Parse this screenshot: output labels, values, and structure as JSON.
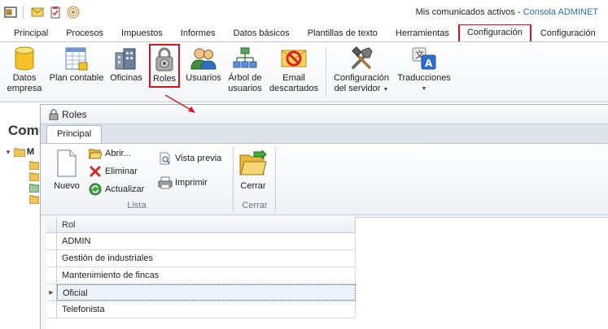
{
  "window": {
    "title_prefix": "Mis comunicados activos - ",
    "app_name": "Consola ADMINET"
  },
  "quick_access": [
    "app-menu-icon",
    "mail-icon",
    "clipboard-check-icon",
    "rss-icon"
  ],
  "menu_tabs": [
    {
      "label": "Principal"
    },
    {
      "label": "Procesos"
    },
    {
      "label": "Impuestos"
    },
    {
      "label": "Informes"
    },
    {
      "label": "Datos básicos"
    },
    {
      "label": "Plantillas de texto"
    },
    {
      "label": "Herramientas"
    },
    {
      "label": "Configuración",
      "active": true
    },
    {
      "label": "Configuración"
    }
  ],
  "ribbon": {
    "datos_empresa": "Datos\nempresa",
    "plan_contable": "Plan contable",
    "oficinas": "Oficinas",
    "roles": "Roles",
    "usuarios": "Usuarios",
    "arbol_usuarios": "Árbol de\nusuarios",
    "email_descartados": "Email\ndescartados",
    "config_servidor": "Configuración\ndel servidor",
    "traducciones": "Traducciones"
  },
  "background": {
    "title": "Comu",
    "tree_root": "M"
  },
  "child_window": {
    "title": "Roles",
    "tab": "Principal",
    "buttons": {
      "nuevo": "Nuevo",
      "abrir": "Abrir...",
      "eliminar": "Eliminar",
      "actualizar": "Actualizar",
      "vista_previa": "Vista previa",
      "imprimir": "Imprimir",
      "cerrar": "Cerrar"
    },
    "groups": {
      "lista": "Lista",
      "cerrar": "Cerrar"
    }
  },
  "grid": {
    "column": "Rol",
    "rows": [
      "ADMIN",
      "Gestión de industriales",
      "Mantenimiento de fincas",
      "Oficial",
      "Telefonista"
    ],
    "selected_index": 3
  },
  "colors": {
    "highlight": "#d9141e",
    "app_name": "#2a6ebb"
  }
}
